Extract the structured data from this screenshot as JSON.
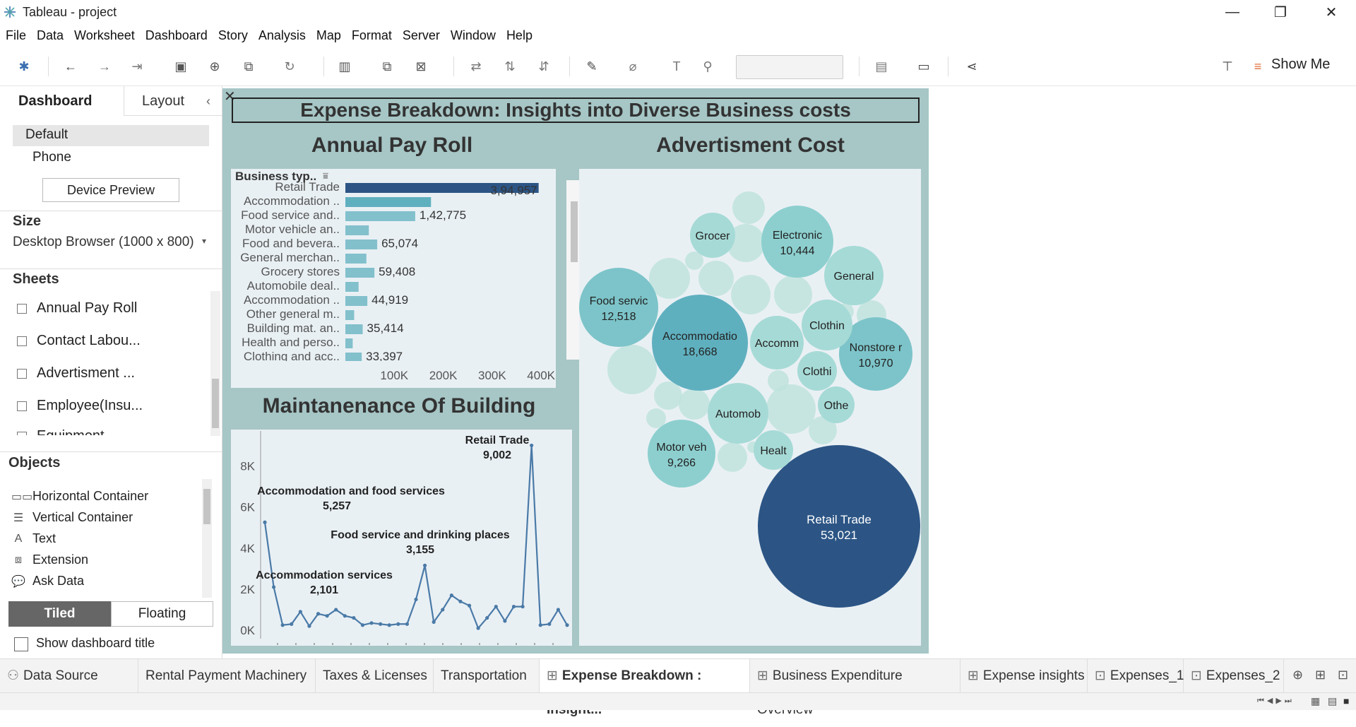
{
  "window": {
    "title": "Tableau - project",
    "minimize": "—",
    "maximize": "❐",
    "close": "✕"
  },
  "menu": [
    "File",
    "Data",
    "Worksheet",
    "Dashboard",
    "Story",
    "Analysis",
    "Map",
    "Format",
    "Server",
    "Window",
    "Help"
  ],
  "toolbar": {
    "show_me": "Show Me"
  },
  "left_pane": {
    "tabs": [
      "Dashboard",
      "Layout"
    ],
    "devices": [
      "Default",
      "Phone"
    ],
    "device_preview": "Device Preview",
    "size_label": "Size",
    "size_value": "Desktop Browser (1000 x 800)",
    "sheets_label": "Sheets",
    "sheets": [
      "Annual Pay Roll",
      "Contact Labou...",
      "Advertisment ...",
      "Employee(Insu...",
      "Equipment"
    ],
    "objects_label": "Objects",
    "objects": [
      {
        "label": "Horizontal Container",
        "icon": "horizontal-container-icon"
      },
      {
        "label": "Vertical Container",
        "icon": "vertical-container-icon"
      },
      {
        "label": "Text",
        "icon": "text-icon"
      },
      {
        "label": "Extension",
        "icon": "extension-icon"
      },
      {
        "label": "Ask Data",
        "icon": "ask-data-icon"
      }
    ],
    "tiled": "Tiled",
    "floating": "Floating",
    "show_title": "Show dashboard title"
  },
  "dashboard": {
    "title": "Expense Breakdown: Insights into Diverse Business costs",
    "payroll_title": "Annual Pay Roll",
    "adv_title": "Advertisment Cost",
    "maint_title": "Maintanenance Of Building"
  },
  "chart_data": [
    {
      "type": "bar",
      "title": "Annual Pay Roll",
      "column_header": "Business typ..",
      "categories": [
        "Retail Trade",
        "Accommodation ..",
        "Food service and..",
        "Motor vehicle an..",
        "Food and bevera..",
        "General merchan..",
        "Grocery stores",
        "Automobile deal..",
        "Accommodation ..",
        "Other general m..",
        "Building mat. an..",
        "Health and perso..",
        "Clothing and acc.."
      ],
      "values": [
        394957,
        175000,
        142775,
        48000,
        65074,
        43000,
        59408,
        27000,
        44919,
        18000,
        35414,
        15000,
        33397
      ],
      "value_labels": [
        "3,94,957",
        "",
        "1,42,775",
        "",
        "65,074",
        "",
        "59,408",
        "",
        "44,919",
        "",
        "35,414",
        "",
        "33,397"
      ],
      "x_ticks": [
        "100K",
        "200K",
        "300K",
        "400K"
      ],
      "xlim": [
        0,
        420000
      ]
    },
    {
      "type": "bubble",
      "title": "Advertisment Cost",
      "bubbles": [
        {
          "label": "Retail Trade",
          "value": "53,021"
        },
        {
          "label": "Accommodatio",
          "value": "18,668"
        },
        {
          "label": "Food servic",
          "value": "12,518"
        },
        {
          "label": "Nonstore r",
          "value": "10,970"
        },
        {
          "label": "Electronic",
          "value": "10,444"
        },
        {
          "label": "Motor veh",
          "value": "9,266"
        },
        {
          "label": "Grocer",
          "value": ""
        },
        {
          "label": "General",
          "value": ""
        },
        {
          "label": "Clothin",
          "value": ""
        },
        {
          "label": "Accomm",
          "value": ""
        },
        {
          "label": "Clothi",
          "value": ""
        },
        {
          "label": "Othe",
          "value": ""
        },
        {
          "label": "Automob",
          "value": ""
        },
        {
          "label": "Healt",
          "value": ""
        }
      ]
    },
    {
      "type": "line",
      "title": "Maintanenance Of Building",
      "values": [
        5257,
        2101,
        250,
        300,
        900,
        200,
        800,
        700,
        1000,
        700,
        600,
        250,
        350,
        300,
        250,
        300,
        300,
        1500,
        3155,
        400,
        1000,
        1700,
        1400,
        1200,
        100,
        600,
        1150,
        450,
        1150,
        1150,
        9002,
        250,
        300,
        1000,
        250
      ],
      "y_ticks": [
        "0K",
        "2K",
        "4K",
        "6K",
        "8K"
      ],
      "ylim": [
        0,
        9500
      ],
      "annotations": [
        {
          "label": "Retail Trade",
          "value": "9,002",
          "index": 30
        },
        {
          "label": "Accommodation and food services",
          "value": "5,257",
          "index": 0
        },
        {
          "label": "Food service and drinking places",
          "value": "3,155",
          "index": 18
        },
        {
          "label": "Accommodation services",
          "value": "2,101",
          "index": 1
        }
      ]
    }
  ],
  "bottom_tabs": [
    {
      "label": "Data Source",
      "icon": "data-source-icon",
      "active": false
    },
    {
      "label": "Rental Payment Machinery",
      "icon": "",
      "active": false
    },
    {
      "label": "Taxes & Licenses",
      "icon": "",
      "active": false
    },
    {
      "label": "Transportation",
      "icon": "",
      "active": false
    },
    {
      "label": "Expense Breakdown : Insight...",
      "icon": "dashboard-icon",
      "active": true
    },
    {
      "label": "Business Expenditure Overview",
      "icon": "dashboard-icon",
      "active": false
    },
    {
      "label": "Expense insights",
      "icon": "dashboard-icon",
      "active": false
    },
    {
      "label": "Expenses_1",
      "icon": "story-icon",
      "active": false
    },
    {
      "label": "Expenses_2",
      "icon": "story-icon",
      "active": false
    }
  ]
}
